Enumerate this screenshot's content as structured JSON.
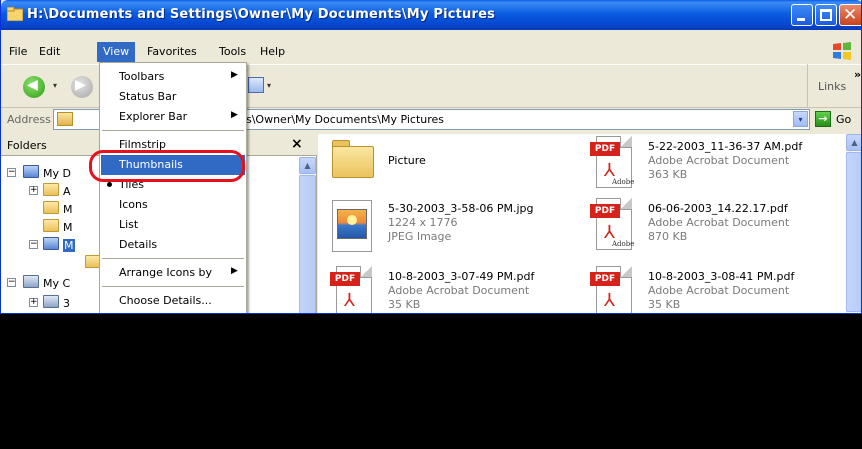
{
  "title_bar": {
    "title": "H:\\Documents and Settings\\Owner\\My Documents\\My Pictures",
    "icon": "folder-icon",
    "buttons": [
      "minimize-icon",
      "maximize-icon",
      "close-icon"
    ],
    "close_glyph": "✕"
  },
  "menu_bar": {
    "items": [
      "File",
      "Edit",
      "View",
      "Favorites",
      "Tools",
      "Help"
    ],
    "active": "View"
  },
  "toolbar": {
    "back_glyph": "◀",
    "forward_glyph": "▶",
    "dropdown_glyph": "▾",
    "links_label": "Links",
    "links_chevron": "»"
  },
  "address_bar": {
    "label": "Address",
    "value": "gs\\Owner\\My Documents\\My Pictures",
    "dropdown_glyph": "▾",
    "go_label": "Go",
    "go_glyph": "→"
  },
  "folders_pane": {
    "title": "Folders",
    "close_glyph": "×",
    "scroll_up_glyph": "▲",
    "tree": [
      {
        "label": "My D",
        "expander": "⊟",
        "icon": "folder-icon"
      },
      {
        "label": "A",
        "expander": "⊞",
        "icon": "folder-icon"
      },
      {
        "label": "M",
        "expander": "",
        "icon": "folder-icon"
      },
      {
        "label": "M",
        "expander": "",
        "icon": "folder-icon"
      },
      {
        "label": "M",
        "expander": "⊟",
        "icon": "folder-icon",
        "selected": true
      },
      {
        "label": "",
        "expander": "",
        "icon": "folder-icon"
      },
      {
        "label": "My C",
        "expander": "⊟",
        "icon": "computer-icon"
      },
      {
        "label": "3",
        "expander": "⊞",
        "icon": "drive-icon"
      }
    ]
  },
  "files_pane": {
    "scroll_up_glyph": "▲",
    "items": [
      {
        "name": "Picture",
        "type": "",
        "size": "",
        "icon": "folder-icon"
      },
      {
        "name": "5-22-2003_11-36-37 AM.pdf",
        "type": "Adobe Acrobat Document",
        "size": "363 KB",
        "icon": "pdf-icon"
      },
      {
        "name": "5-30-2003_3-58-06 PM.jpg",
        "type": "1224 x 1776",
        "size": "JPEG Image",
        "icon": "jpeg-icon"
      },
      {
        "name": "06-06-2003_14.22.17.pdf",
        "type": "Adobe Acrobat Document",
        "size": "870 KB",
        "icon": "pdf-icon"
      },
      {
        "name": "10-8-2003_3-07-49 PM.pdf",
        "type": "Adobe Acrobat Document",
        "size": "35 KB",
        "icon": "pdf-icon"
      },
      {
        "name": "10-8-2003_3-08-41 PM.pdf",
        "type": "Adobe Acrobat Document",
        "size": "35 KB",
        "icon": "pdf-icon"
      }
    ],
    "pdf_badge": "PDF",
    "adobe_label": "Adobe"
  },
  "view_menu": {
    "items": [
      {
        "label": "Toolbars",
        "submenu": true
      },
      {
        "label": "Status Bar",
        "submenu": false
      },
      {
        "label": "Explorer Bar",
        "submenu": true
      },
      {
        "label": "Filmstrip",
        "submenu": false
      },
      {
        "label": "Thumbnails",
        "submenu": false,
        "highlighted": true
      },
      {
        "label": "Tiles",
        "submenu": false,
        "checked": true
      },
      {
        "label": "Icons",
        "submenu": false
      },
      {
        "label": "List",
        "submenu": false
      },
      {
        "label": "Details",
        "submenu": false
      },
      {
        "label": "Arrange Icons by",
        "submenu": true
      },
      {
        "label": "Choose Details...",
        "submenu": false
      }
    ],
    "submenu_arrow": "▶"
  },
  "colors": {
    "title_bar": "#0b5ce1",
    "menu_highlight": "#316ac5",
    "annotation_ring": "#e8101a",
    "window_face": "#ece9d8"
  }
}
